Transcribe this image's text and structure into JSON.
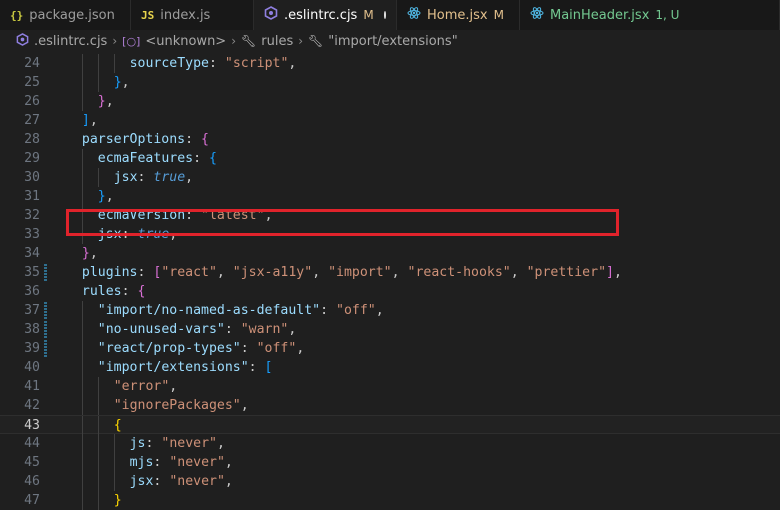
{
  "tabs": [
    {
      "icon": "{}",
      "label": "package.json",
      "status": "",
      "active": false
    },
    {
      "icon": "JS",
      "label": "index.js",
      "status": "",
      "active": false
    },
    {
      "icon": "eslint",
      "label": ".eslintrc.cjs",
      "status": "M",
      "active": true
    },
    {
      "icon": "react",
      "label": "Home.jsx",
      "status": "M",
      "active": false
    },
    {
      "icon": "react",
      "label": "MainHeader.jsx",
      "status": "1, U",
      "active": false
    }
  ],
  "breadcrumb": {
    "file": ".eslintrc.cjs",
    "unknown": "<unknown>",
    "rules": "rules",
    "ext": "\"import/extensions\""
  },
  "colors": {
    "key": "#9cdcfe",
    "string": "#ce9178",
    "bool": "#569cd6",
    "highlight": "#e0232b"
  },
  "lines": [
    {
      "n": "24",
      "indent": 8,
      "tokens": [
        {
          "t": "sourceType",
          "c": "k"
        },
        {
          "t": ": ",
          "c": "p"
        },
        {
          "t": "\"script\"",
          "c": "s"
        },
        {
          "t": ",",
          "c": "p"
        }
      ]
    },
    {
      "n": "25",
      "indent": 6,
      "tokens": [
        {
          "t": "}",
          "c": "br3"
        },
        {
          "t": ",",
          "c": "p"
        }
      ]
    },
    {
      "n": "26",
      "indent": 4,
      "tokens": [
        {
          "t": "}",
          "c": "br2"
        },
        {
          "t": ",",
          "c": "p"
        }
      ]
    },
    {
      "n": "27",
      "indent": 2,
      "tokens": [
        {
          "t": "]",
          "c": "br3"
        },
        {
          "t": ",",
          "c": "p"
        }
      ]
    },
    {
      "n": "28",
      "indent": 2,
      "tokens": [
        {
          "t": "parserOptions",
          "c": "k"
        },
        {
          "t": ": ",
          "c": "p"
        },
        {
          "t": "{",
          "c": "br2"
        }
      ]
    },
    {
      "n": "29",
      "indent": 4,
      "tokens": [
        {
          "t": "ecmaFeatures",
          "c": "k"
        },
        {
          "t": ": ",
          "c": "p"
        },
        {
          "t": "{",
          "c": "br3"
        }
      ]
    },
    {
      "n": "30",
      "indent": 6,
      "tokens": [
        {
          "t": "jsx",
          "c": "k"
        },
        {
          "t": ": ",
          "c": "p"
        },
        {
          "t": "true",
          "c": "b"
        },
        {
          "t": ",",
          "c": "p"
        }
      ]
    },
    {
      "n": "31",
      "indent": 4,
      "tokens": [
        {
          "t": "}",
          "c": "br3"
        },
        {
          "t": ",",
          "c": "p"
        }
      ]
    },
    {
      "n": "32",
      "indent": 4,
      "tokens": [
        {
          "t": "ecmaVersion",
          "c": "k"
        },
        {
          "t": ": ",
          "c": "p"
        },
        {
          "t": "\"latest\"",
          "c": "s"
        },
        {
          "t": ",",
          "c": "p"
        }
      ]
    },
    {
      "n": "33",
      "indent": 4,
      "tokens": [
        {
          "t": "jsx",
          "c": "k"
        },
        {
          "t": ": ",
          "c": "p"
        },
        {
          "t": "true",
          "c": "b"
        },
        {
          "t": ",",
          "c": "p"
        }
      ]
    },
    {
      "n": "34",
      "indent": 2,
      "tokens": [
        {
          "t": "}",
          "c": "br2"
        },
        {
          "t": ",",
          "c": "p"
        }
      ]
    },
    {
      "n": "35",
      "indent": 2,
      "mark": true,
      "tokens": [
        {
          "t": "plugins",
          "c": "k"
        },
        {
          "t": ": ",
          "c": "p"
        },
        {
          "t": "[",
          "c": "br2"
        },
        {
          "t": "\"react\"",
          "c": "s"
        },
        {
          "t": ", ",
          "c": "p"
        },
        {
          "t": "\"jsx-a11y\"",
          "c": "s"
        },
        {
          "t": ", ",
          "c": "p"
        },
        {
          "t": "\"import\"",
          "c": "s"
        },
        {
          "t": ", ",
          "c": "p"
        },
        {
          "t": "\"react-hooks\"",
          "c": "s"
        },
        {
          "t": ", ",
          "c": "p"
        },
        {
          "t": "\"prettier\"",
          "c": "s"
        },
        {
          "t": "]",
          "c": "br2"
        },
        {
          "t": ",",
          "c": "p"
        }
      ]
    },
    {
      "n": "36",
      "indent": 2,
      "tokens": [
        {
          "t": "rules",
          "c": "k"
        },
        {
          "t": ": ",
          "c": "p"
        },
        {
          "t": "{",
          "c": "br2"
        }
      ]
    },
    {
      "n": "37",
      "indent": 4,
      "mark": true,
      "tokens": [
        {
          "t": "\"import/no-named-as-default\"",
          "c": "k"
        },
        {
          "t": ": ",
          "c": "p"
        },
        {
          "t": "\"off\"",
          "c": "s"
        },
        {
          "t": ",",
          "c": "p"
        }
      ]
    },
    {
      "n": "38",
      "indent": 4,
      "mark": true,
      "tokens": [
        {
          "t": "\"no-unused-vars\"",
          "c": "k"
        },
        {
          "t": ": ",
          "c": "p"
        },
        {
          "t": "\"warn\"",
          "c": "s"
        },
        {
          "t": ",",
          "c": "p"
        }
      ]
    },
    {
      "n": "39",
      "indent": 4,
      "mark": true,
      "tokens": [
        {
          "t": "\"react/prop-types\"",
          "c": "k"
        },
        {
          "t": ": ",
          "c": "p"
        },
        {
          "t": "\"off\"",
          "c": "s"
        },
        {
          "t": ",",
          "c": "p"
        }
      ]
    },
    {
      "n": "40",
      "indent": 4,
      "tokens": [
        {
          "t": "\"import/extensions\"",
          "c": "k"
        },
        {
          "t": ": ",
          "c": "p"
        },
        {
          "t": "[",
          "c": "br3"
        }
      ]
    },
    {
      "n": "41",
      "indent": 6,
      "tokens": [
        {
          "t": "\"error\"",
          "c": "s"
        },
        {
          "t": ",",
          "c": "p"
        }
      ]
    },
    {
      "n": "42",
      "indent": 6,
      "tokens": [
        {
          "t": "\"ignorePackages\"",
          "c": "s"
        },
        {
          "t": ",",
          "c": "p"
        }
      ]
    },
    {
      "n": "43",
      "indent": 6,
      "current": true,
      "tokens": [
        {
          "t": "{",
          "c": "br1"
        }
      ]
    },
    {
      "n": "44",
      "indent": 8,
      "tokens": [
        {
          "t": "js",
          "c": "k"
        },
        {
          "t": ": ",
          "c": "p"
        },
        {
          "t": "\"never\"",
          "c": "s"
        },
        {
          "t": ",",
          "c": "p"
        }
      ]
    },
    {
      "n": "45",
      "indent": 8,
      "tokens": [
        {
          "t": "mjs",
          "c": "k"
        },
        {
          "t": ": ",
          "c": "p"
        },
        {
          "t": "\"never\"",
          "c": "s"
        },
        {
          "t": ",",
          "c": "p"
        }
      ]
    },
    {
      "n": "46",
      "indent": 8,
      "tokens": [
        {
          "t": "jsx",
          "c": "k"
        },
        {
          "t": ": ",
          "c": "p"
        },
        {
          "t": "\"never\"",
          "c": "s"
        },
        {
          "t": ",",
          "c": "p"
        }
      ]
    },
    {
      "n": "47",
      "indent": 6,
      "tokens": [
        {
          "t": "}",
          "c": "br1"
        }
      ]
    }
  ]
}
